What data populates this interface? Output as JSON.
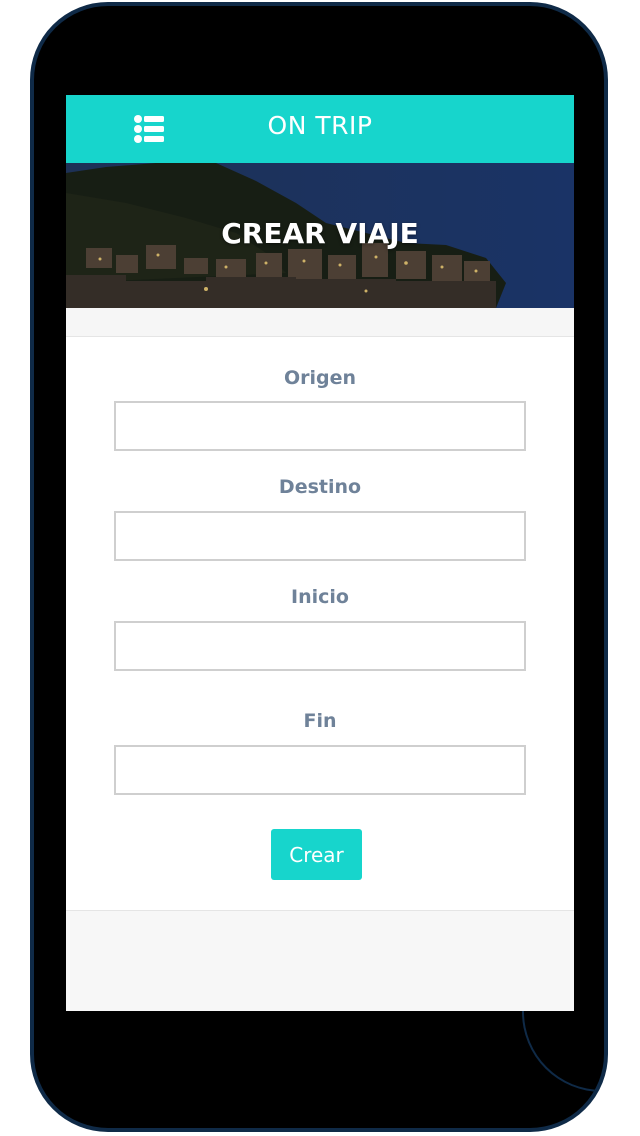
{
  "app": {
    "brand": "ON TRIP",
    "menu_icon": "list-icon",
    "accent_color": "#17d5cc",
    "label_color": "#6f8299"
  },
  "hero": {
    "title": "CREAR VIAJE"
  },
  "form": {
    "origen_label": "Origen",
    "origen_value": "",
    "destino_label": "Destino",
    "destino_value": "",
    "inicio_label": "Inicio",
    "inicio_value": "",
    "fin_label": "Fin",
    "fin_value": "",
    "submit_label": "Crear"
  }
}
